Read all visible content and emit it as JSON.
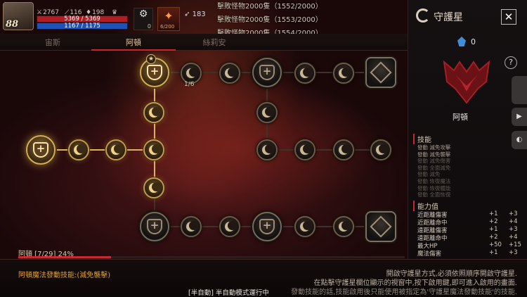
{
  "hud": {
    "level": "88",
    "stat_a": "2767",
    "stat_b": "116",
    "stat_c": "198",
    "hp": "5369 / 5369",
    "mp": "1167 / 1175",
    "gear_count": "0",
    "skill_cooldown": "6/200",
    "wing_value": "183"
  },
  "quests": [
    "擊敗怪物2000隻（1552/2000）",
    "擊敗怪物2000隻（1553/2000）",
    "擊敗怪物2000隻（1554/2000）"
  ],
  "tabs": [
    "宙斯",
    "阿頓",
    "絲莉安"
  ],
  "active_tab": "阿頓",
  "tree": {
    "top_node_progress": "1/6"
  },
  "progress": {
    "label": "阿頓 [7/29] 24%",
    "fraction": 0.24
  },
  "bottom": {
    "skill_line": "阿頓魔法發動技能:(減免襲擊)",
    "hints": [
      "開啟守護星方式,必須依照順序開啟守護星.",
      "在點擊守護星欄位顯示的視窗中,按下啟用鍵,即可進入啟用的畫面.",
      "發動技能的話,技能啟用後只能使用被指定為'守護星魔法發動技能'的技能."
    ],
    "mode": "[半自動] 半自動模式運行中"
  },
  "panel": {
    "title": "守護星",
    "gem_count": "0",
    "crest_name": "阿頓",
    "skills_header": "技能",
    "skills": [
      {
        "label": "發動 減免攻擊",
        "active": true
      },
      {
        "label": "發動 減免襲擊",
        "active": true
      },
      {
        "label": "發動 減免傷害",
        "active": false
      },
      {
        "label": "發動 全面減免",
        "active": false
      },
      {
        "label": "發動 減免",
        "active": false
      },
      {
        "label": "發動 恢復魔法",
        "active": false
      },
      {
        "label": "發動 恢復體能",
        "active": false
      },
      {
        "label": "發動 全面恢復",
        "active": false
      }
    ],
    "attrs_header": "能力值",
    "attrs": [
      {
        "name": "近距離傷害",
        "cur": "+1",
        "next": "+3"
      },
      {
        "name": "近距離命中",
        "cur": "+2",
        "next": "+4"
      },
      {
        "name": "遠距離傷害",
        "cur": "+1",
        "next": "+3"
      },
      {
        "name": "遠距離命中",
        "cur": "+2",
        "next": "+4"
      },
      {
        "name": "最大HP",
        "cur": "+50",
        "next": "+15"
      },
      {
        "name": "魔法傷害",
        "cur": "+1",
        "next": "+3"
      }
    ]
  },
  "colors": {
    "accent_red": "#c62a30",
    "gold": "#d8ab55",
    "skill_orange": "#e2a030"
  }
}
